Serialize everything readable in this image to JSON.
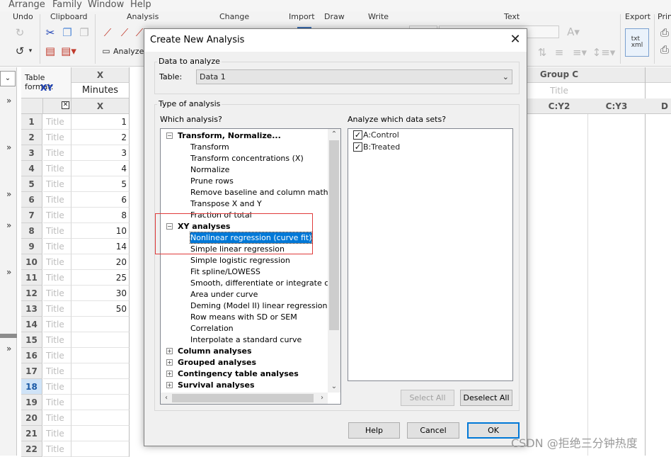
{
  "menu": [
    "Arrange",
    "Family",
    "Window",
    "Help"
  ],
  "ribbon": {
    "groups": [
      "Undo",
      "Clipboard",
      "Analysis",
      "Change",
      "Import",
      "Draw",
      "Write",
      "Text",
      "Export",
      "Prin"
    ],
    "analyze_label": "Analyze",
    "export_icon_label": "txt\nxml"
  },
  "sheet": {
    "table_format_label": "Table format:",
    "table_format_value": "XY",
    "x_header": "X",
    "x_title": "Minutes",
    "x_subheader": "X",
    "group_c_header": "Group C",
    "group_c_title": "Title",
    "col_headers": [
      "C:Y2",
      "C:Y3",
      "D"
    ],
    "title_placeholder": "Title",
    "rows": [
      {
        "n": "1",
        "x": "1"
      },
      {
        "n": "2",
        "x": "2"
      },
      {
        "n": "3",
        "x": "3"
      },
      {
        "n": "4",
        "x": "4"
      },
      {
        "n": "5",
        "x": "5"
      },
      {
        "n": "6",
        "x": "6"
      },
      {
        "n": "7",
        "x": "8"
      },
      {
        "n": "8",
        "x": "10"
      },
      {
        "n": "9",
        "x": "14"
      },
      {
        "n": "10",
        "x": "20"
      },
      {
        "n": "11",
        "x": "25"
      },
      {
        "n": "12",
        "x": "30"
      },
      {
        "n": "13",
        "x": "50"
      },
      {
        "n": "14",
        "x": ""
      },
      {
        "n": "15",
        "x": ""
      },
      {
        "n": "16",
        "x": ""
      },
      {
        "n": "17",
        "x": ""
      },
      {
        "n": "18",
        "x": ""
      },
      {
        "n": "19",
        "x": ""
      },
      {
        "n": "20",
        "x": ""
      },
      {
        "n": "21",
        "x": ""
      },
      {
        "n": "22",
        "x": ""
      }
    ],
    "selected_row": "18"
  },
  "dialog": {
    "title": "Create New Analysis",
    "data_to_analyze_legend": "Data to analyze",
    "table_label": "Table:",
    "table_value": "Data 1",
    "type_legend": "Type of analysis",
    "which_analysis_label": "Which analysis?",
    "analyze_which_label": "Analyze which data sets?",
    "tree": [
      {
        "label": "Transform, Normalize...",
        "level": 0,
        "expander": "−"
      },
      {
        "label": "Transform",
        "level": 1
      },
      {
        "label": "Transform concentrations (X)",
        "level": 1
      },
      {
        "label": "Normalize",
        "level": 1
      },
      {
        "label": "Prune rows",
        "level": 1
      },
      {
        "label": "Remove baseline and column math",
        "level": 1
      },
      {
        "label": "Transpose X and Y",
        "level": 1
      },
      {
        "label": "Fraction of total",
        "level": 1
      },
      {
        "label": "XY analyses",
        "level": 0,
        "expander": "−"
      },
      {
        "label": "Nonlinear regression (curve fit)",
        "level": 1,
        "selected": true
      },
      {
        "label": "Simple linear regression",
        "level": 1
      },
      {
        "label": "Simple logistic regression",
        "level": 1
      },
      {
        "label": "Fit spline/LOWESS",
        "level": 1
      },
      {
        "label": "Smooth, differentiate or integrate curve",
        "level": 1
      },
      {
        "label": "Area under curve",
        "level": 1
      },
      {
        "label": "Deming (Model II) linear regression",
        "level": 1
      },
      {
        "label": "Row means with SD or SEM",
        "level": 1
      },
      {
        "label": "Correlation",
        "level": 1
      },
      {
        "label": "Interpolate a standard curve",
        "level": 1
      },
      {
        "label": "Column analyses",
        "level": 0,
        "expander": "+"
      },
      {
        "label": "Grouped analyses",
        "level": 0,
        "expander": "+"
      },
      {
        "label": "Contingency table analyses",
        "level": 0,
        "expander": "+"
      },
      {
        "label": "Survival analyses",
        "level": 0,
        "expander": "+"
      }
    ],
    "datasets": [
      {
        "label": "A:Control",
        "checked": true
      },
      {
        "label": "B:Treated",
        "checked": true
      }
    ],
    "select_all": "Select All",
    "deselect_all": "Deselect All",
    "help": "Help",
    "cancel": "Cancel",
    "ok": "OK"
  },
  "watermark": "CSDN @拒绝三分钟热度",
  "colors": {
    "selection": "#0078d7",
    "highlight_box": "#e03b3b",
    "xy_blue": "#1b3fb5"
  }
}
